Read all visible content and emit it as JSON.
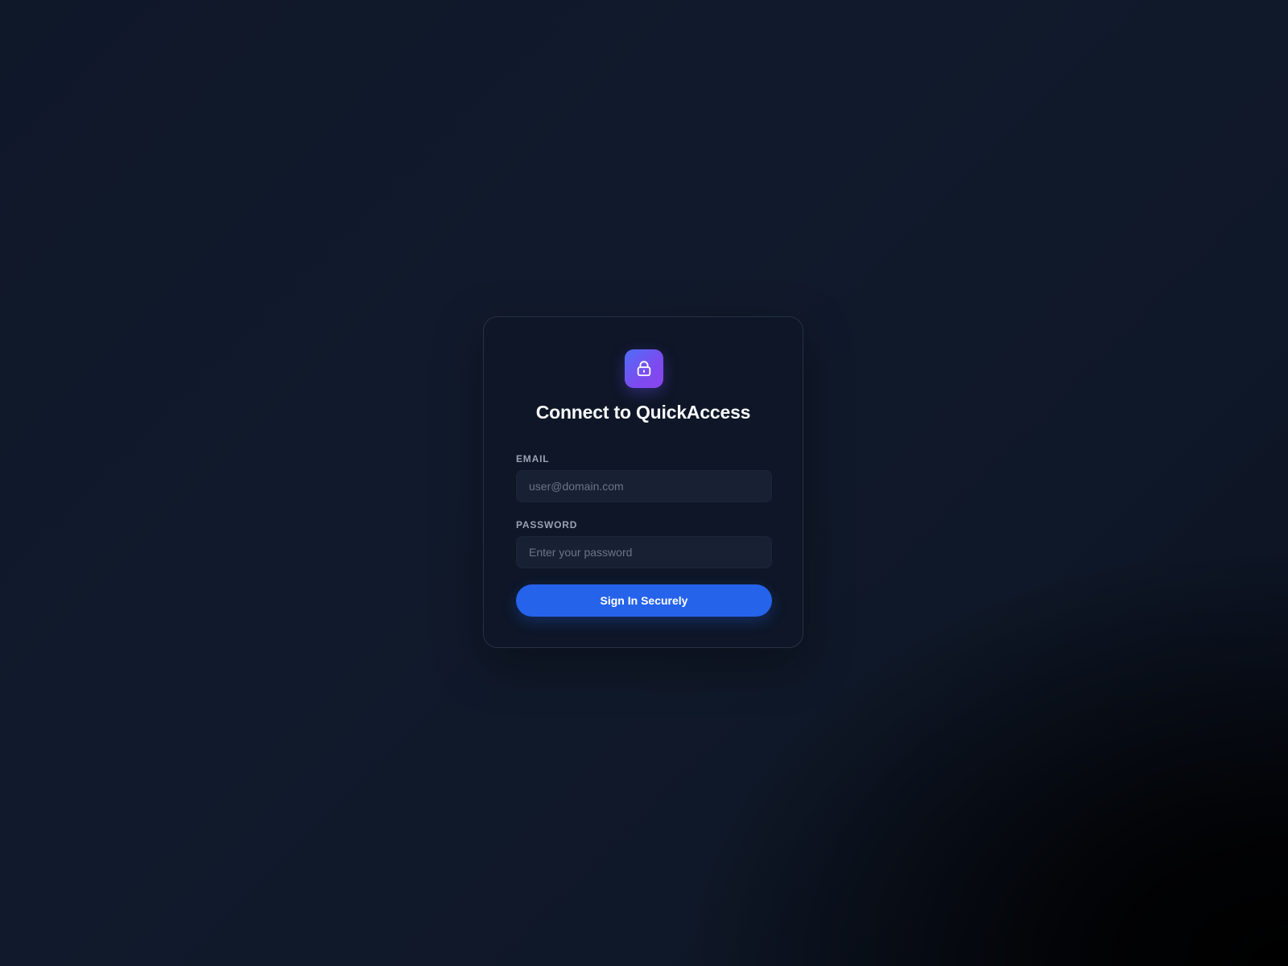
{
  "login": {
    "logo_icon": "lock-icon",
    "title": "Connect to QuickAccess",
    "email": {
      "label": "EMAIL",
      "placeholder": "user@domain.com",
      "value": ""
    },
    "password": {
      "label": "PASSWORD",
      "placeholder": "Enter your password",
      "value": ""
    },
    "submit_label": "Sign In Securely"
  },
  "colors": {
    "accent": "#2563eb",
    "logo_gradient_start": "#4f6ef7",
    "logo_gradient_end": "#8b45ee",
    "background": "#0f172a",
    "card": "#0e1627"
  }
}
